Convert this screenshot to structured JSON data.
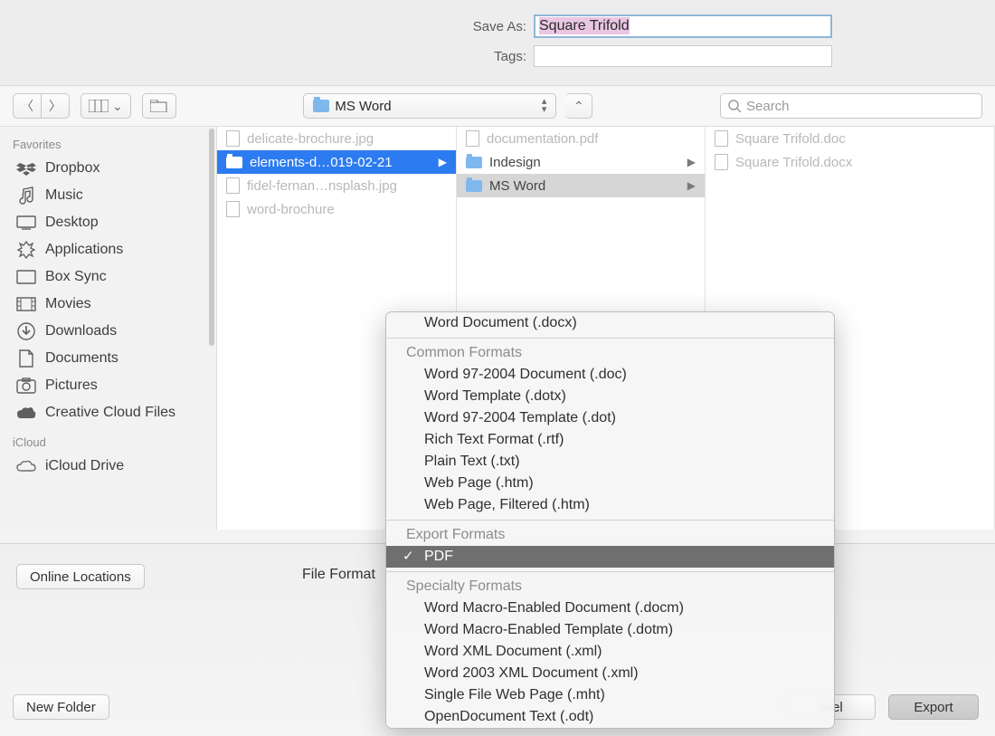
{
  "form": {
    "saveAsLabel": "Save As:",
    "saveAsValue": "Square Trifold",
    "tagsLabel": "Tags:",
    "tagsValue": ""
  },
  "toolbar": {
    "currentFolder": "MS Word",
    "searchPlaceholder": "Search"
  },
  "sidebar": {
    "section1": "Favorites",
    "items": [
      {
        "icon": "dropbox",
        "label": "Dropbox"
      },
      {
        "icon": "music",
        "label": "Music"
      },
      {
        "icon": "desktop",
        "label": "Desktop"
      },
      {
        "icon": "apps",
        "label": "Applications"
      },
      {
        "icon": "box",
        "label": "Box Sync"
      },
      {
        "icon": "movies",
        "label": "Movies"
      },
      {
        "icon": "downloads",
        "label": "Downloads"
      },
      {
        "icon": "documents",
        "label": "Documents"
      },
      {
        "icon": "pictures",
        "label": "Pictures"
      },
      {
        "icon": "cc",
        "label": "Creative Cloud Files"
      }
    ],
    "section2": "iCloud",
    "icloudItem": "iCloud Drive"
  },
  "columns": {
    "c1": [
      {
        "label": "delicate-brochure.jpg",
        "type": "file",
        "dim": true
      },
      {
        "label": "elements-d…019-02-21",
        "type": "folder",
        "sel": "blue",
        "arrow": true
      },
      {
        "label": "fidel-fernan…nsplash.jpg",
        "type": "file",
        "dim": true
      },
      {
        "label": "word-brochure",
        "type": "doc",
        "dim": true
      }
    ],
    "c2": [
      {
        "label": "documentation.pdf",
        "type": "pdf",
        "dim": true
      },
      {
        "label": "Indesign",
        "type": "folder",
        "arrow": true
      },
      {
        "label": "MS Word",
        "type": "folder",
        "sel": "grey",
        "arrow": true
      }
    ],
    "c3": [
      {
        "label": "Square Trifold.doc",
        "type": "doc",
        "dim": true
      },
      {
        "label": "Square Trifold.docx",
        "type": "doc",
        "dim": true
      }
    ]
  },
  "bottom": {
    "onlineLocations": "Online Locations",
    "fileFormatLabel": "File Format",
    "newFolder": "New Folder",
    "cancel": "ncel",
    "export": "Export"
  },
  "dropdown": {
    "topItem": "Word Document (.docx)",
    "commonHeader": "Common Formats",
    "common": [
      "Word 97-2004 Document (.doc)",
      "Word Template (.dotx)",
      "Word 97-2004 Template (.dot)",
      "Rich Text Format (.rtf)",
      "Plain Text (.txt)",
      "Web Page (.htm)",
      "Web Page, Filtered (.htm)"
    ],
    "exportHeader": "Export Formats",
    "selected": "PDF",
    "specialtyHeader": "Specialty Formats",
    "specialty": [
      "Word Macro-Enabled Document (.docm)",
      "Word Macro-Enabled Template (.dotm)",
      "Word XML Document (.xml)",
      "Word 2003 XML Document (.xml)",
      "Single File Web Page (.mht)",
      "OpenDocument Text (.odt)"
    ]
  }
}
